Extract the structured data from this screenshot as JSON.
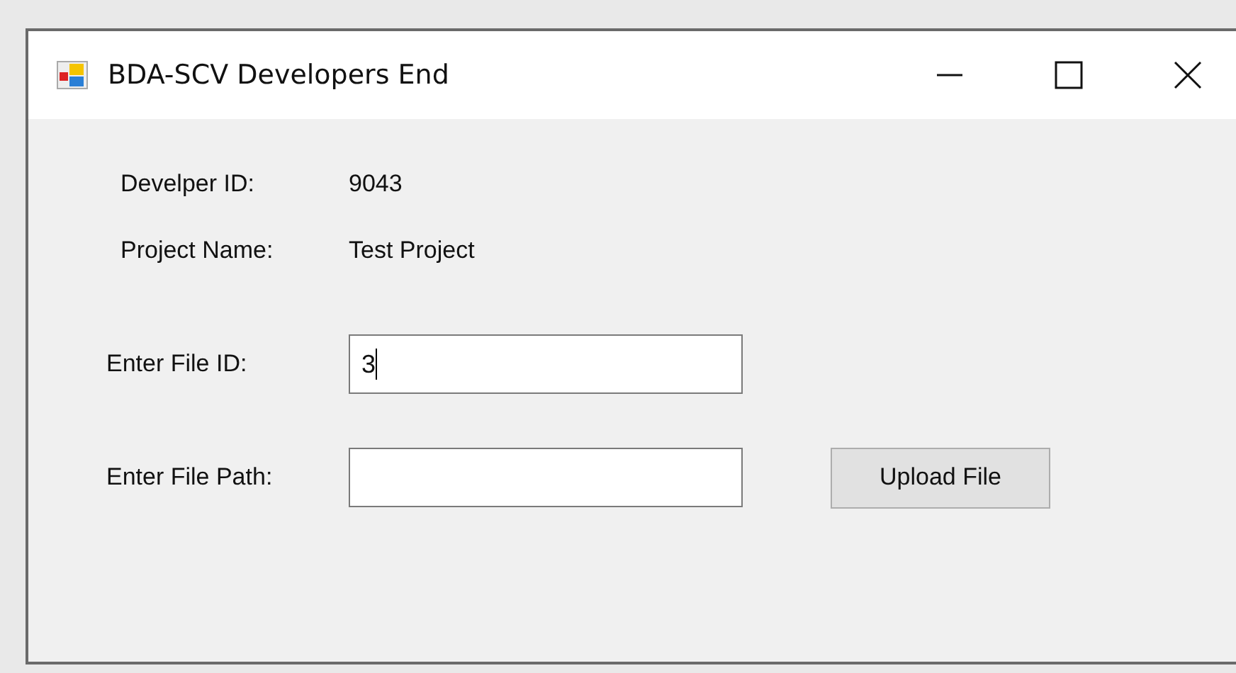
{
  "window": {
    "title": "BDA-SCV Developers End"
  },
  "info": [
    {
      "label": "Develper ID:",
      "value": "9043"
    },
    {
      "label": "Project Name:",
      "value": "Test Project"
    }
  ],
  "fields": [
    {
      "label": "Enter File ID:",
      "value": "3",
      "focused": true
    },
    {
      "label": "Enter File Path:",
      "focused": false
    }
  ],
  "upload_button": "Upload File"
}
